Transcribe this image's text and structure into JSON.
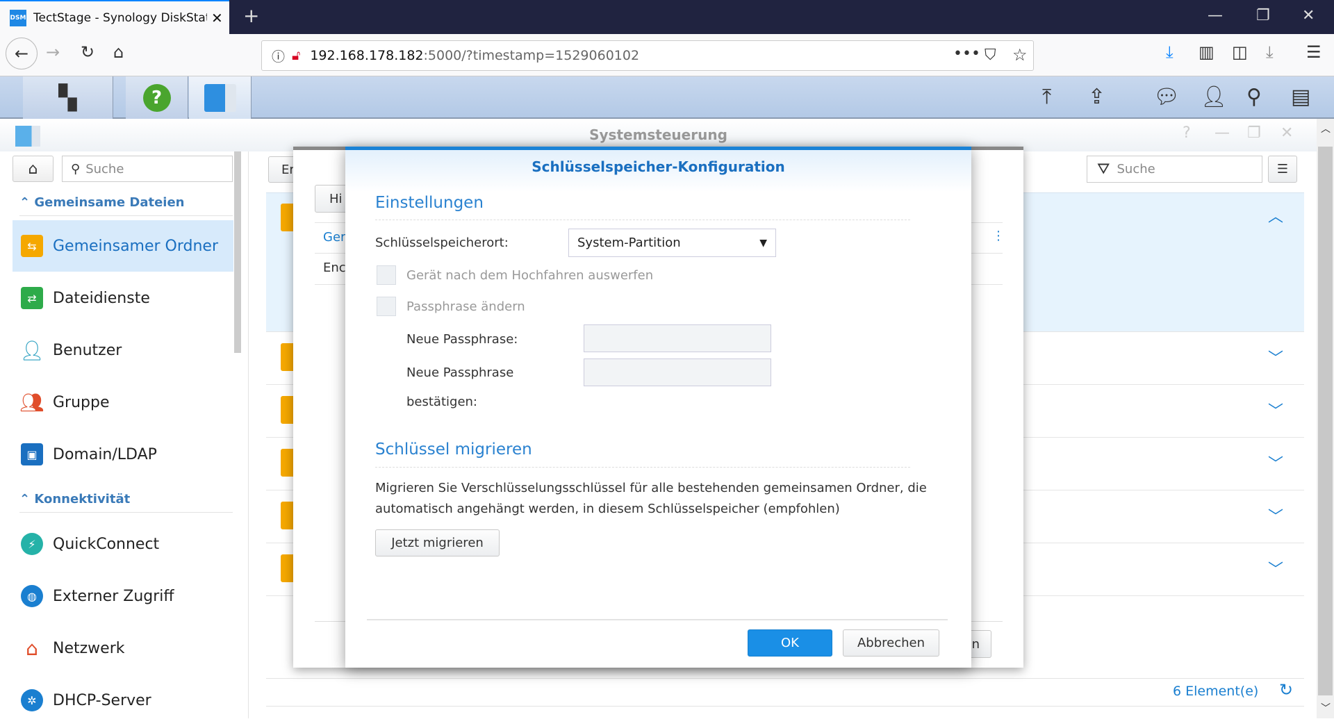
{
  "browser": {
    "tab_title": "TectStage - Synology DiskStatio",
    "tab_favicon": "DSM",
    "url_host": "192.168.178.182",
    "url_rest": ":5000/?timestamp=1529060102"
  },
  "window": {
    "title": "Systemsteuerung"
  },
  "sidebar": {
    "search_placeholder": "Suche",
    "sections": [
      {
        "label": "Gemeinsame Dateien",
        "items": [
          {
            "label": "Gemeinsamer Ordner",
            "selected": true
          },
          {
            "label": "Dateidienste"
          },
          {
            "label": "Benutzer"
          },
          {
            "label": "Gruppe"
          },
          {
            "label": "Domain/LDAP"
          }
        ]
      },
      {
        "label": "Konnektivität",
        "items": [
          {
            "label": "QuickConnect"
          },
          {
            "label": "Externer Zugriff"
          },
          {
            "label": "Netzwerk"
          },
          {
            "label": "DHCP-Server"
          }
        ]
      }
    ]
  },
  "main": {
    "search_placeholder": "Suche",
    "footer_count": "6 Element(e)",
    "behind": {
      "btn": "Er",
      "tab": "Hi",
      "row1": "Ger",
      "row2": "Enc",
      "btn2": "n"
    }
  },
  "dialog": {
    "title": "Schlüsselspeicher-Konfiguration",
    "settings_heading": "Einstellungen",
    "location_label": "Schlüsselspeicherort:",
    "location_value": "System-Partition",
    "eject_label": "Gerät nach dem Hochfahren auswerfen",
    "change_pass_label": "Passphrase ändern",
    "new_pass_label": "Neue Passphrase:",
    "confirm_pass_label_1": "Neue Passphrase",
    "confirm_pass_label_2": "bestätigen:",
    "migrate_heading": "Schlüssel migrieren",
    "migrate_text_1": "Migrieren Sie Verschlüsselungsschlüssel für alle bestehenden gemeinsamen Ordner, die",
    "migrate_text_2": "automatisch angehängt werden, in diesem Schlüsselspeicher (empfohlen)",
    "migrate_button": "Jetzt migrieren",
    "ok": "OK",
    "cancel": "Abbrechen"
  },
  "colors": {
    "accent": "#1a82d6",
    "selected": "#d7eafb",
    "folder": "#f5a800"
  }
}
